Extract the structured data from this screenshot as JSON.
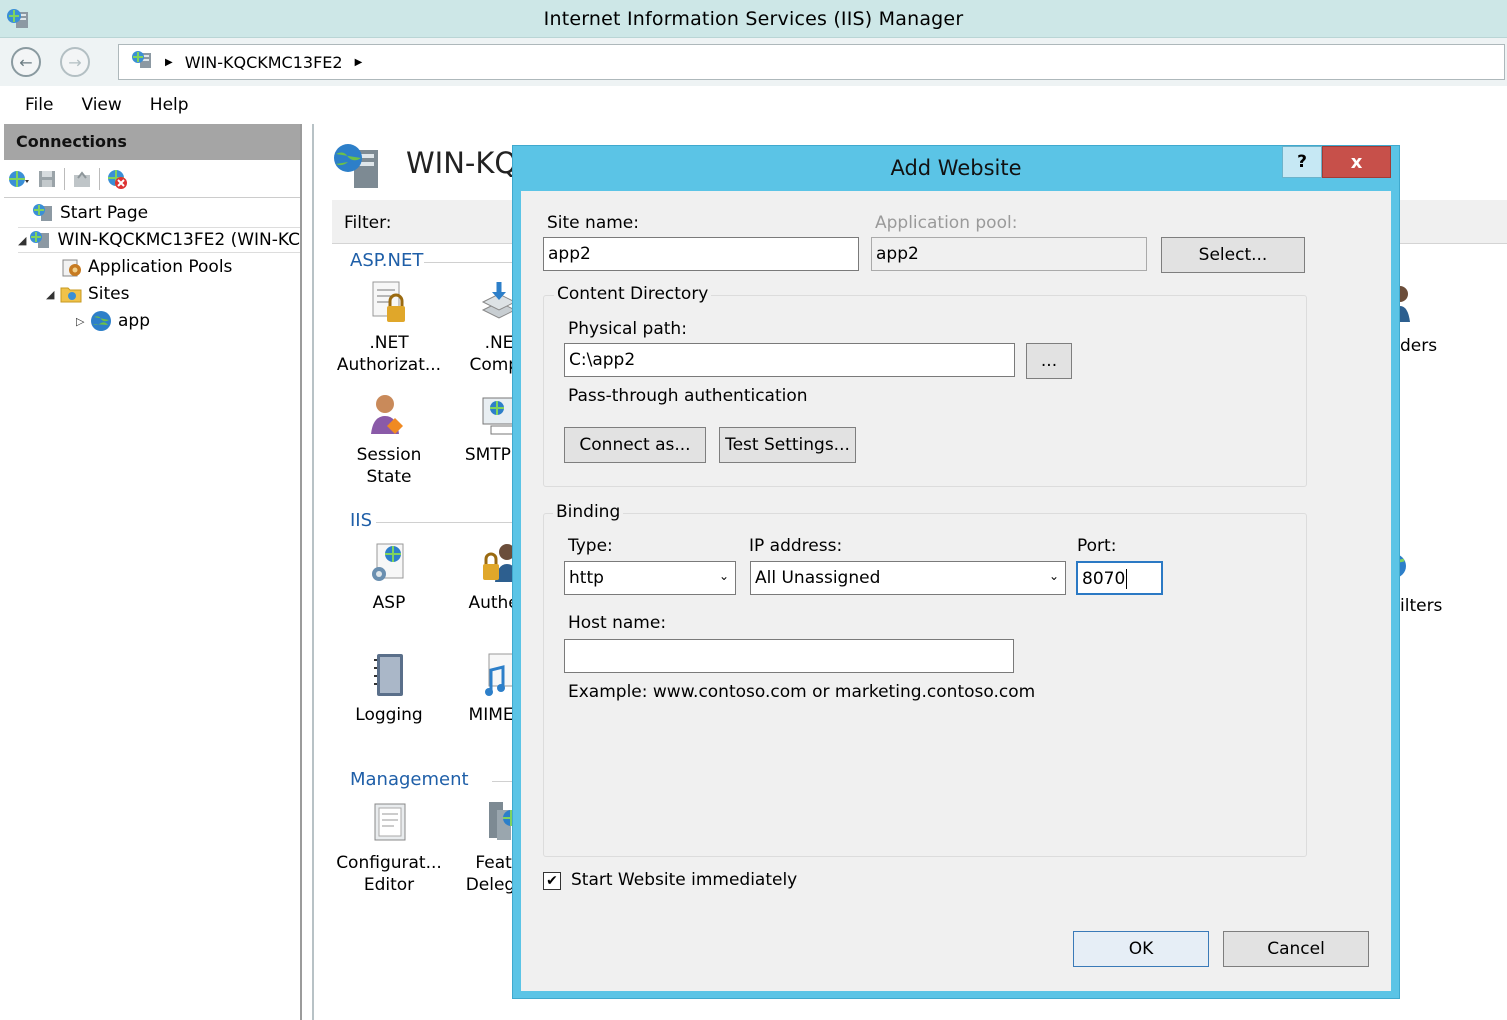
{
  "window": {
    "title": "Internet Information Services (IIS) Manager",
    "address": "WIN-KQCKMC13FE2"
  },
  "menu": [
    "File",
    "View",
    "Help"
  ],
  "connections": {
    "header": "Connections",
    "tree": {
      "start_page": "Start Page",
      "server": "WIN-KQCKMC13FE2 (WIN-KC",
      "app_pools": "Application Pools",
      "sites": "Sites",
      "site_app": "app"
    }
  },
  "main": {
    "title": "WIN-KQ",
    "filter_label": "Filter:",
    "groups": {
      "aspnet": "ASP.NET",
      "iis": "IIS",
      "management": "Management"
    },
    "features": {
      "net_auth": [
        ".NET",
        "Authorizat..."
      ],
      "net_comp": [
        ".NE",
        "Compil"
      ],
      "session_state": "Session State",
      "smtp": "SMTP E-",
      "asp": "ASP",
      "authen": "Authen",
      "logging": "Logging",
      "mime": "MIME T",
      "config_editor": [
        "Configurat...",
        "Editor"
      ],
      "feature_deleg": [
        "Featu",
        "Delegat"
      ],
      "right_ders": "ders",
      "right_ilters": "ilters"
    }
  },
  "dialog": {
    "title": "Add Website",
    "help": "?",
    "close": "x",
    "site_name_label": "Site name:",
    "site_name_value": "app2",
    "app_pool_label": "Application pool:",
    "app_pool_value": "app2",
    "select_button": "Select...",
    "content_dir_title": "Content Directory",
    "physical_path_label": "Physical path:",
    "physical_path_value": "C:\\app2",
    "browse_button": "...",
    "pass_through": "Pass-through authentication",
    "connect_as_button": "Connect as...",
    "test_settings_button": "Test Settings...",
    "binding_title": "Binding",
    "type_label": "Type:",
    "type_value": "http",
    "ip_label": "IP address:",
    "ip_value": "All Unassigned",
    "port_label": "Port:",
    "port_value": "8070",
    "host_label": "Host name:",
    "host_value": "",
    "example": "Example: www.contoso.com or marketing.contoso.com",
    "start_label": "Start Website immediately",
    "start_checked": true,
    "ok_button": "OK",
    "cancel_button": "Cancel"
  },
  "icons": {
    "app": "iis-manager-icon",
    "back": "back-arrow-icon",
    "forward": "forward-arrow-icon",
    "checkmark": "✔"
  }
}
